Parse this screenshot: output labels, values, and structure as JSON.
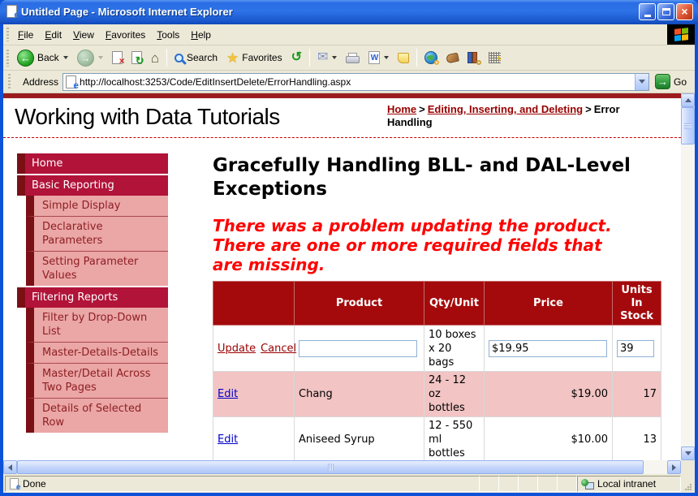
{
  "window": {
    "title": "Untitled Page - Microsoft Internet Explorer"
  },
  "menu": {
    "items": [
      "File",
      "Edit",
      "View",
      "Favorites",
      "Tools",
      "Help"
    ]
  },
  "toolbar": {
    "back_label": "Back",
    "search_label": "Search",
    "favorites_label": "Favorites"
  },
  "address": {
    "label": "Address",
    "url": "http://localhost:3253/Code/EditInsertDelete/ErrorHandling.aspx",
    "go_label": "Go"
  },
  "masthead": {
    "title": "Working with Data Tutorials",
    "separator": ">",
    "breadcrumb": [
      {
        "label": "Home",
        "link": true
      },
      {
        "label": "Editing, Inserting, and Deleting",
        "link": true
      },
      {
        "label": "Error Handling",
        "link": false
      }
    ]
  },
  "sidebar": {
    "items": [
      {
        "label": "Home",
        "level": 1
      },
      {
        "label": "Basic Reporting",
        "level": 1
      },
      {
        "label": "Simple Display",
        "level": 2
      },
      {
        "label": "Declarative Parameters",
        "level": 2
      },
      {
        "label": "Setting Parameter Values",
        "level": 2
      },
      {
        "label": "Filtering Reports",
        "level": 1
      },
      {
        "label": "Filter by Drop-Down List",
        "level": 2
      },
      {
        "label": "Master-Details-Details",
        "level": 2
      },
      {
        "label": "Master/Detail Across Two Pages",
        "level": 2
      },
      {
        "label": "Details of Selected Row",
        "level": 2
      }
    ]
  },
  "content": {
    "heading": "Gracefully Handling BLL- and DAL-Level Exceptions",
    "error_message": "There was a problem updating the product. There are one or more required fields that are missing.",
    "table": {
      "headers": [
        "",
        "Product",
        "Qty/Unit",
        "Price",
        "Units In Stock"
      ],
      "rows": [
        {
          "type": "editing",
          "update_label": "Update",
          "cancel_label": "Cancel",
          "product_value": "",
          "qty_unit": "10 boxes x 20 bags",
          "price_value": "$19.95",
          "units_value": "39"
        },
        {
          "type": "view",
          "edit_label": "Edit",
          "product": "Chang",
          "qty_unit": "24 - 12 oz bottles",
          "price": "$19.00",
          "units": "17"
        },
        {
          "type": "view",
          "edit_label": "Edit",
          "product": "Aniseed Syrup",
          "qty_unit": "12 - 550 ml bottles",
          "price": "$10.00",
          "units": "13"
        }
      ]
    }
  },
  "status": {
    "done_label": "Done",
    "zone_label": "Local intranet"
  },
  "icons": {
    "ie_e": "e",
    "close": "×",
    "left_arrow": "←",
    "right_arrow": "→",
    "stop_x": "×",
    "refresh": "↻",
    "home": "⌂",
    "star": "★",
    "history": "↺",
    "mail": "✉",
    "word": "W",
    "go_arrow": "→",
    "lightning": "ϟ"
  },
  "colors": {
    "titlebar_blue": "#2a6ce4",
    "window_border": "#0d52d8",
    "chrome_beige": "#ece9d8",
    "masthead_band": "#9b1c1f",
    "nav_top_bg": "#b11339",
    "nav_strip": "#7a1016",
    "nav_sub_bg": "#eba6a6",
    "nav_sub_text": "#8d2024",
    "table_header_bg": "#a40a0c",
    "row_alt_pink": "#f2c4c4",
    "error_red": "#ff0000",
    "link_dark_red": "#990000",
    "link_blue": "#0000cc"
  }
}
